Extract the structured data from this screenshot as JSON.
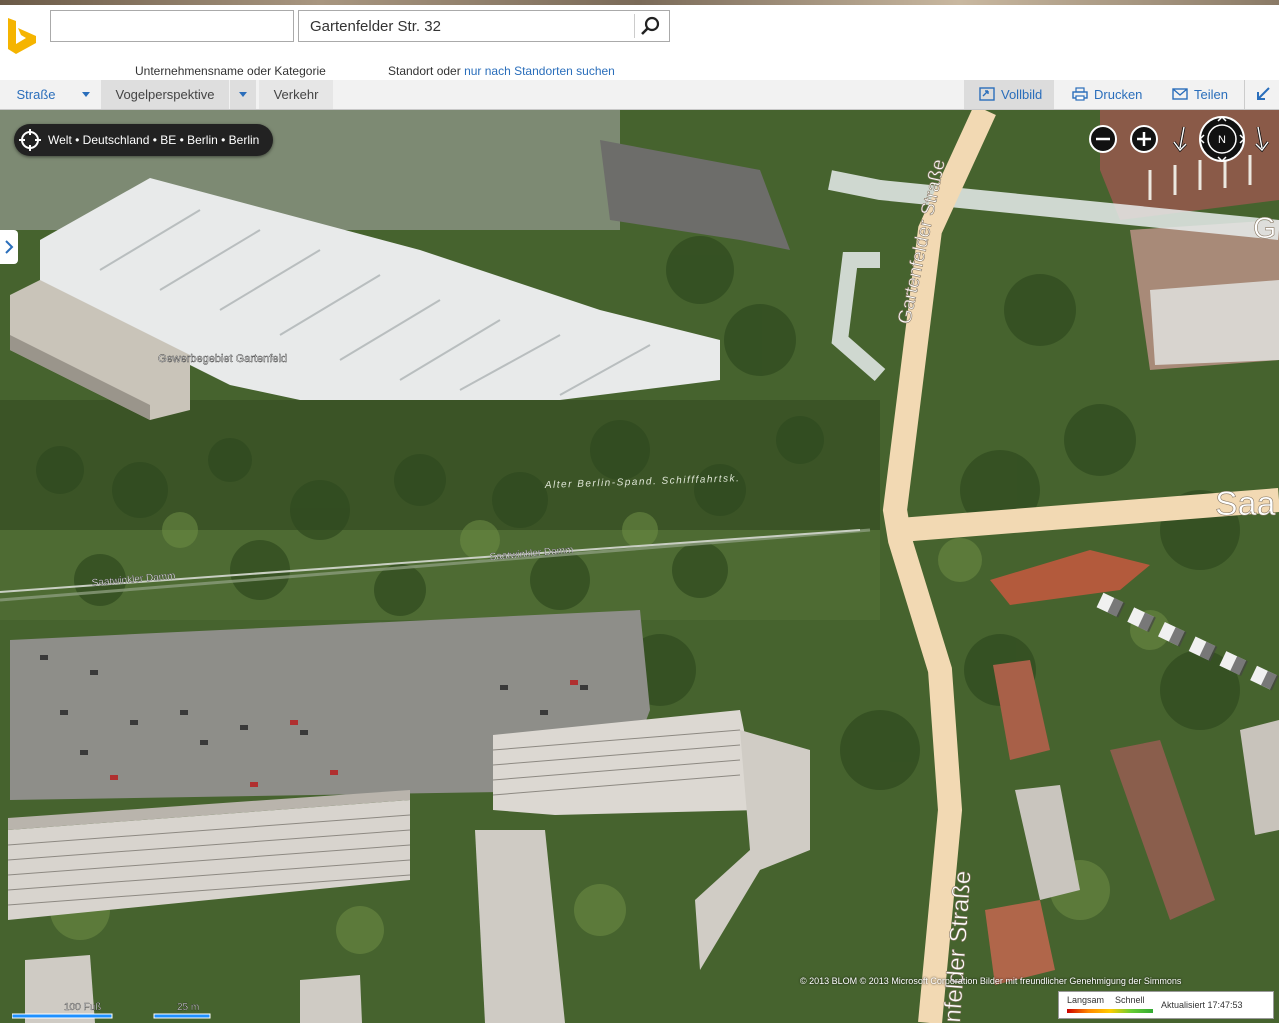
{
  "search": {
    "business_value": "",
    "business_label": "Unternehmensname oder Kategorie",
    "location_value": "Gartenfelder Str. 32",
    "location_label": "Standort oder",
    "location_link": "nur nach Standorten suchen"
  },
  "toolbar": {
    "tab_street": "Straße",
    "tab_birdseye": "Vogelperspektive",
    "tab_traffic": "Verkehr",
    "fullscreen": "Vollbild",
    "print": "Drucken",
    "share": "Teilen"
  },
  "breadcrumb": "Welt • Deutschland • BE • Berlin • Berlin",
  "compass_label": "N",
  "map_labels": {
    "gewerbe": "Gewerbegebiet Gartenfeld",
    "kanal": "Alter Berlin-Spand. Schifffahrtsk.",
    "saatwinkler1": "Saatwinkler Damm",
    "saatwinkler2": "Saatwinkler Damm",
    "gartenfelder_top": "Gartenfelder Straße",
    "gartenfelder_bottom": "nfelder Straße",
    "saat_partial": "Saa",
    "g_partial": "G"
  },
  "scale": {
    "feet": "100 Fuß",
    "meters": "25 m"
  },
  "copyright": "© 2013 BLOM   © 2013 Microsoft Corporation   Bilder mit freundlicher Genehmigung der Simmons",
  "traffic": {
    "slow": "Langsam",
    "fast": "Schnell",
    "updated": "Aktualisiert 17:47:53"
  },
  "colors": {
    "accent": "#2a6ebb",
    "bing_yellow": "#f5b400",
    "road": "#f2d9b3"
  }
}
